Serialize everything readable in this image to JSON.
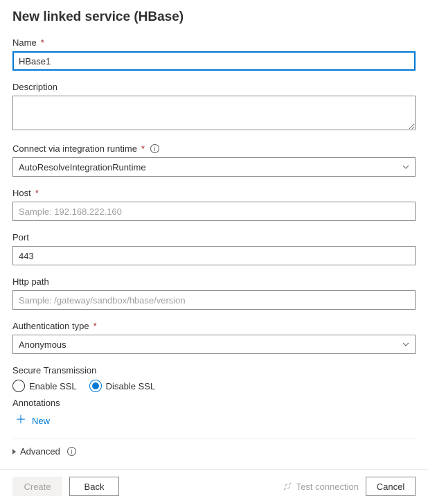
{
  "title": "New linked service (HBase)",
  "fields": {
    "name": {
      "label": "Name",
      "value": "HBase1"
    },
    "description": {
      "label": "Description",
      "value": ""
    },
    "runtime": {
      "label": "Connect via integration runtime",
      "value": "AutoResolveIntegrationRuntime"
    },
    "host": {
      "label": "Host",
      "value": "",
      "placeholder": "Sample: 192.168.222.160"
    },
    "port": {
      "label": "Port",
      "value": "443"
    },
    "httpPath": {
      "label": "Http path",
      "value": "",
      "placeholder": "Sample: /gateway/sandbox/hbase/version"
    },
    "authType": {
      "label": "Authentication type",
      "value": "Anonymous"
    }
  },
  "secureTransmission": {
    "label": "Secure Transmission",
    "options": {
      "enable": "Enable SSL",
      "disable": "Disable SSL"
    }
  },
  "annotations": {
    "label": "Annotations",
    "newLabel": "New"
  },
  "advanced": {
    "label": "Advanced"
  },
  "footer": {
    "create": "Create",
    "back": "Back",
    "test": "Test connection",
    "cancel": "Cancel"
  }
}
